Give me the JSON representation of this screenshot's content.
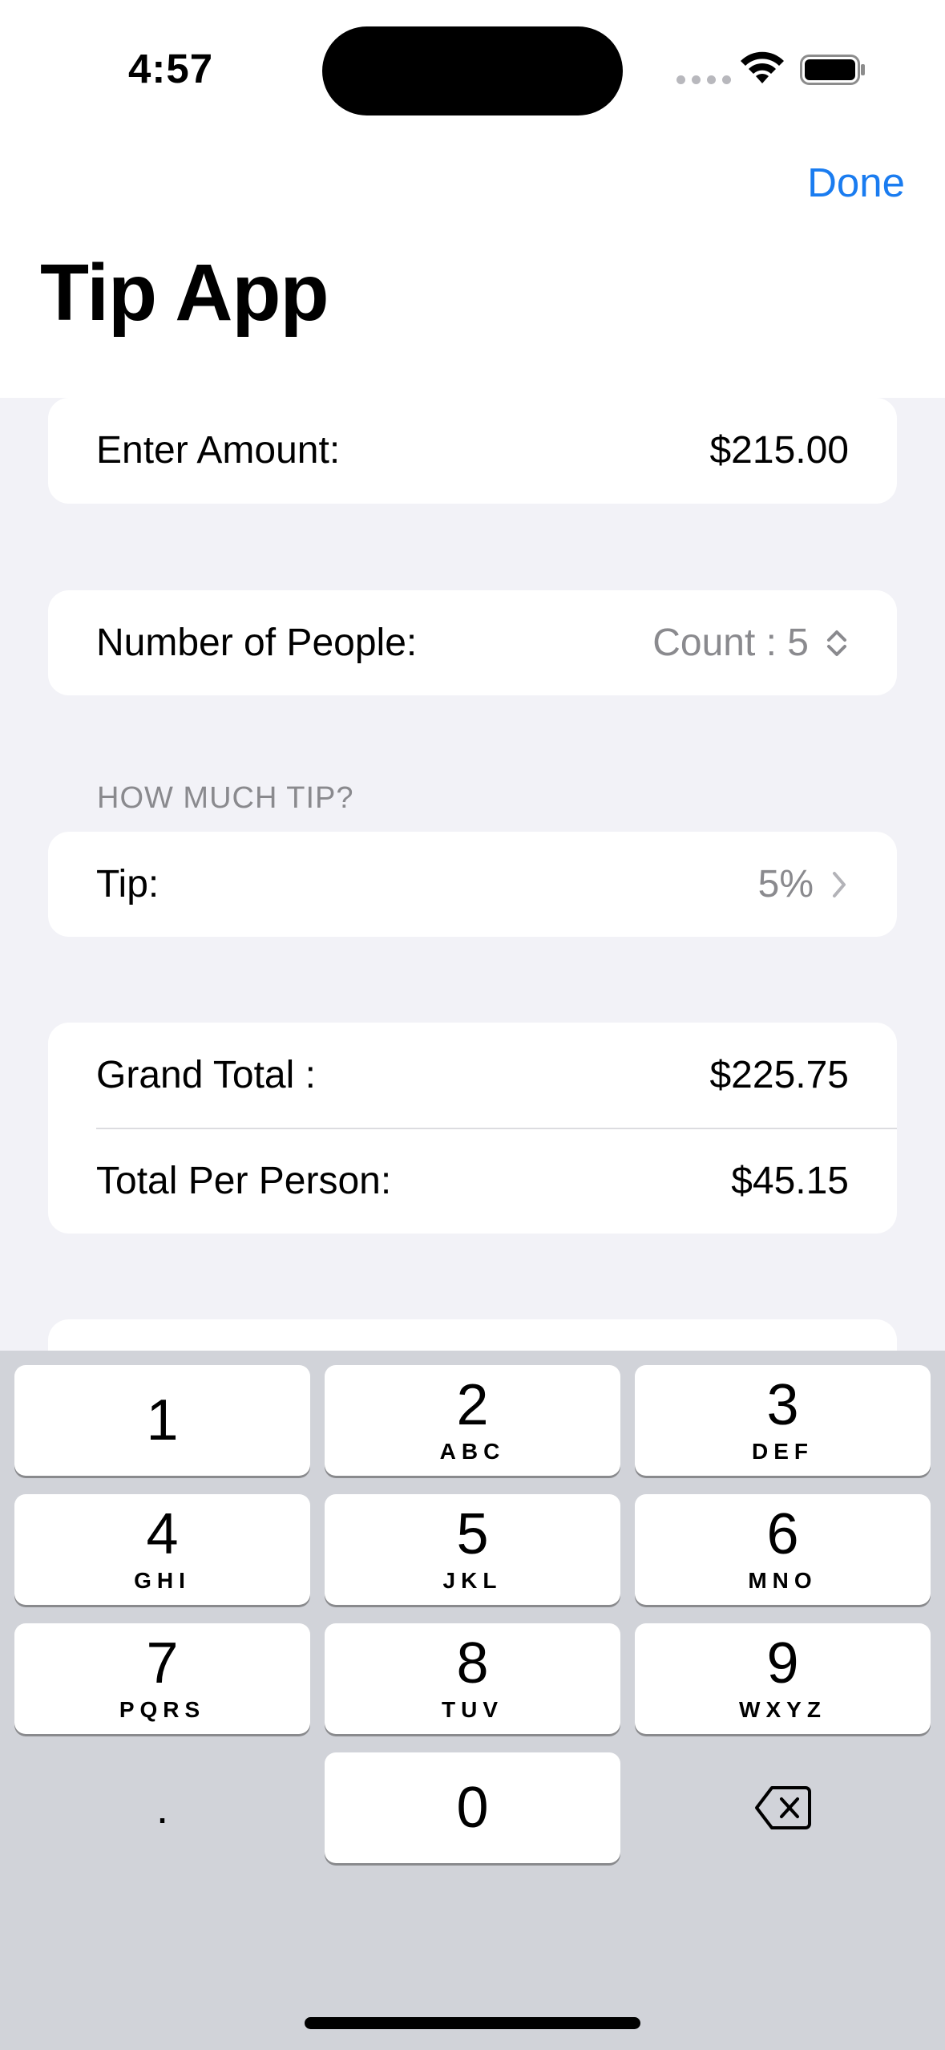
{
  "status": {
    "time": "4:57"
  },
  "nav": {
    "done_label": "Done",
    "title": "Tip App"
  },
  "form": {
    "amount": {
      "label": "Enter Amount:",
      "value": "$215.00"
    },
    "people": {
      "label": "Number of People:",
      "value": "Count : 5"
    },
    "tip_section": {
      "header": "HOW MUCH TIP?",
      "label": "Tip:",
      "value": "5%"
    },
    "totals": {
      "grand_total_label": "Grand Total :",
      "grand_total_value": "$225.75",
      "per_person_label": "Total Per Person:",
      "per_person_value": "$45.15"
    }
  },
  "keyboard": {
    "keys": [
      {
        "num": "1",
        "letters": ""
      },
      {
        "num": "2",
        "letters": "ABC"
      },
      {
        "num": "3",
        "letters": "DEF"
      },
      {
        "num": "4",
        "letters": "GHI"
      },
      {
        "num": "5",
        "letters": "JKL"
      },
      {
        "num": "6",
        "letters": "MNO"
      },
      {
        "num": "7",
        "letters": "PQRS"
      },
      {
        "num": "8",
        "letters": "TUV"
      },
      {
        "num": "9",
        "letters": "WXYZ"
      },
      {
        "num": "0",
        "letters": ""
      }
    ],
    "decimal": ".",
    "delete_icon": "delete-backward-icon"
  },
  "colors": {
    "accent": "#1a7cf0",
    "background": "#f2f2f7",
    "keyboard_bg": "#d1d3d9"
  }
}
